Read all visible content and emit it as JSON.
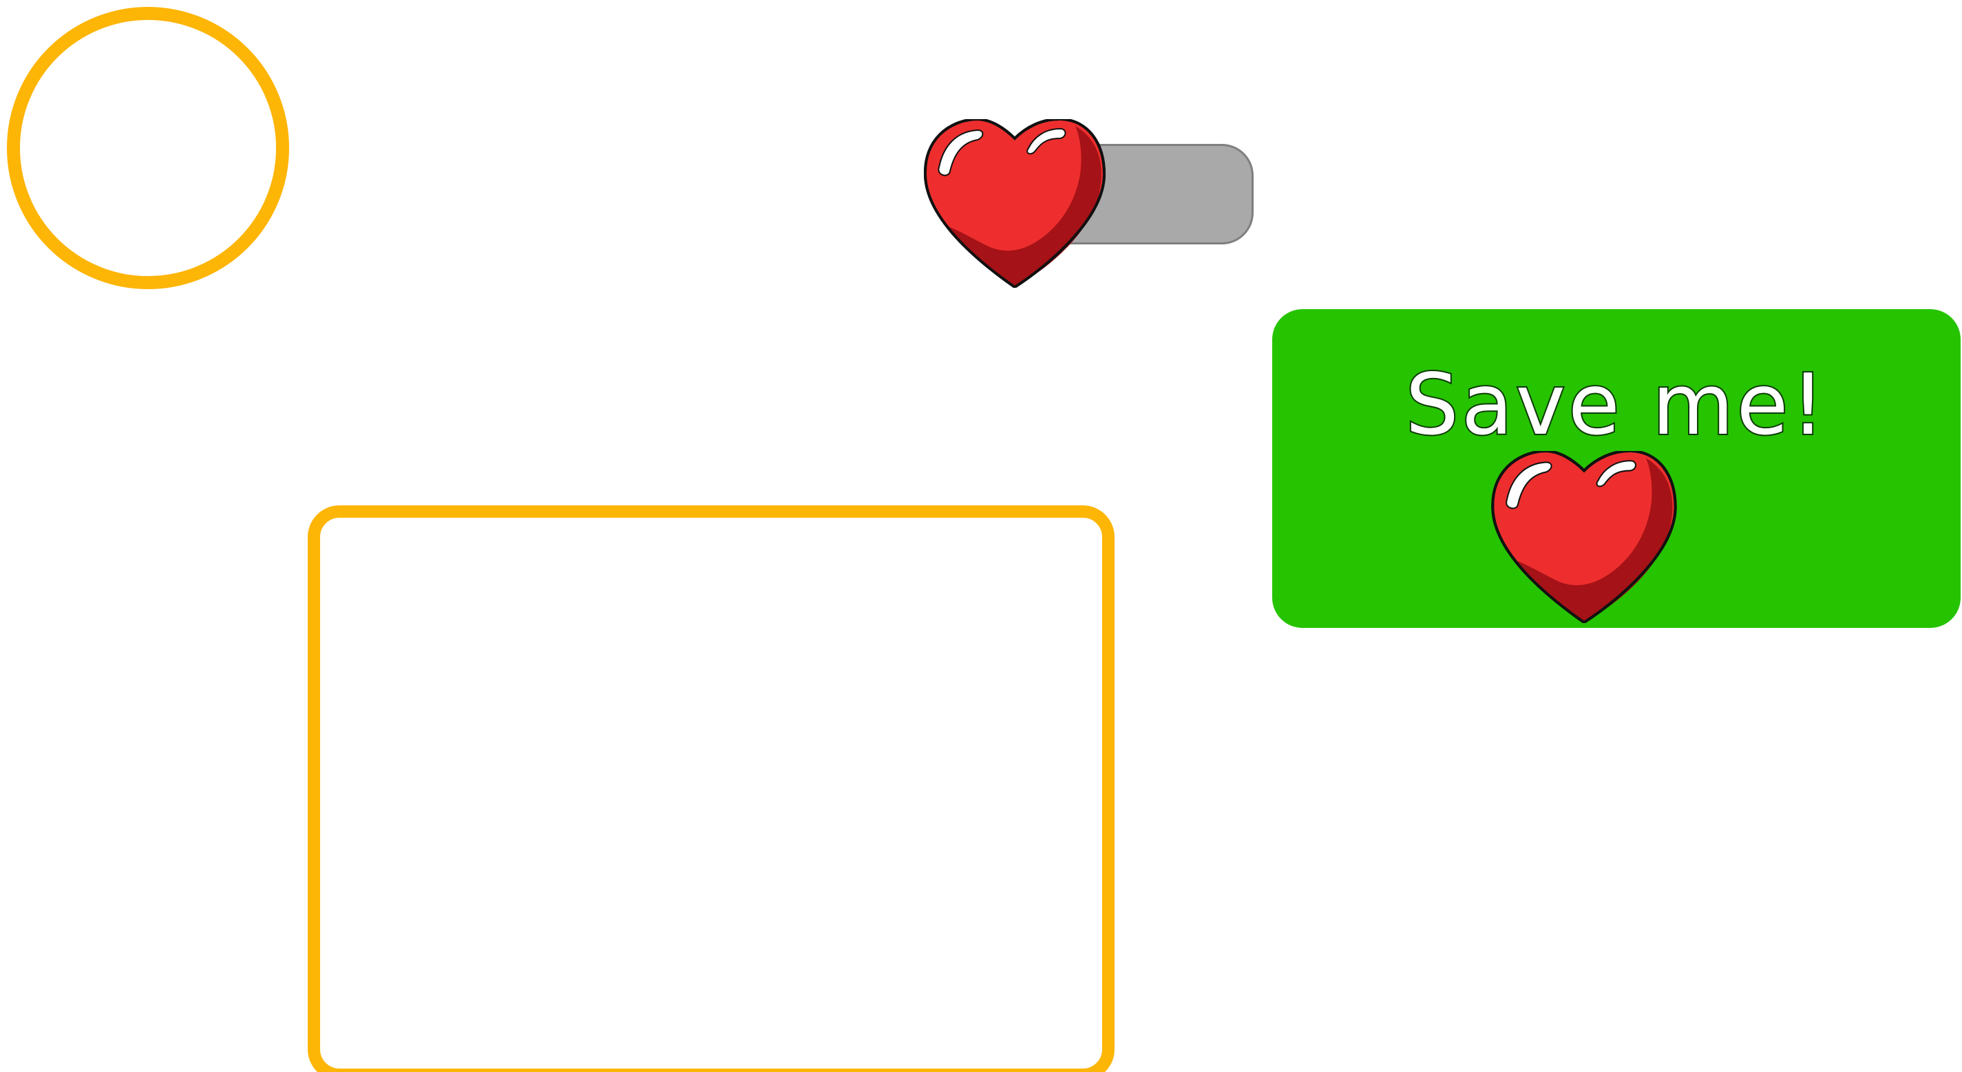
{
  "save_button": {
    "label": "Save me!"
  },
  "colors": {
    "ring": "#FDB506",
    "drop_box": "#FDB506",
    "save_button": "#26C300",
    "grey_bar": "#A9A9A9",
    "heart": "#EE2E2E",
    "heart_shade": "#A51217"
  },
  "icons": {
    "draggable": "heart-icon",
    "button_overlay": "heart-icon"
  }
}
